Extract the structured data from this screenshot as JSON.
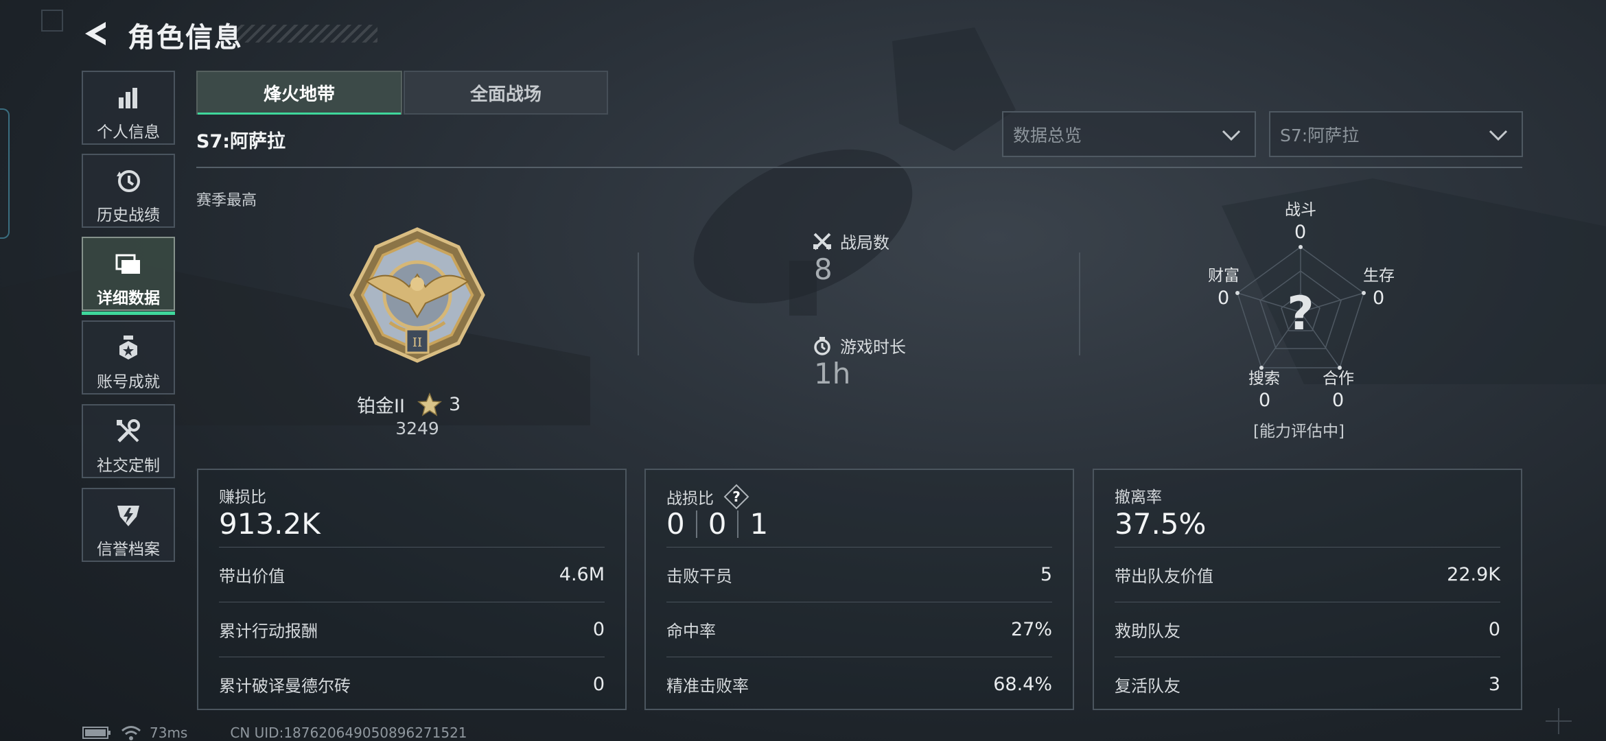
{
  "header": {
    "title": "角色信息"
  },
  "sidebar": {
    "items": [
      {
        "label": "个人信息",
        "icon": "bar-chart-icon"
      },
      {
        "label": "历史战绩",
        "icon": "history-clock-icon"
      },
      {
        "label": "详细数据",
        "icon": "folders-icon",
        "active": true
      },
      {
        "label": "账号成就",
        "icon": "medal-icon"
      },
      {
        "label": "社交定制",
        "icon": "tools-icon"
      },
      {
        "label": "信誉档案",
        "icon": "shield-bolt-icon"
      }
    ]
  },
  "tabs": [
    {
      "label": "烽火地带",
      "active": true
    },
    {
      "label": "全面战场",
      "active": false
    }
  ],
  "season": {
    "title": "S7:阿萨拉"
  },
  "filters": {
    "data_type": "数据总览",
    "season": "S7:阿萨拉"
  },
  "rank": {
    "section_label": "赛季最高",
    "name": "铂金II",
    "stars": "3",
    "score": "3249",
    "badge_numeral": "II"
  },
  "stats": {
    "matches_label": "战局数",
    "matches_value": "8",
    "playtime_label": "游戏时长",
    "playtime_value": "1h"
  },
  "radar": {
    "center_symbol": "?",
    "axes": [
      {
        "label": "战斗",
        "value": "0"
      },
      {
        "label": "生存",
        "value": "0"
      },
      {
        "label": "合作",
        "value": "0"
      },
      {
        "label": "搜索",
        "value": "0"
      },
      {
        "label": "财富",
        "value": "0"
      }
    ],
    "note": "[能力评估中]"
  },
  "panels": {
    "profit": {
      "title": "赚损比",
      "value": "913.2K",
      "rows": [
        {
          "label": "带出价值",
          "value": "4.6M"
        },
        {
          "label": "累计行动报酬",
          "value": "0"
        },
        {
          "label": "累计破译曼德尔砖",
          "value": "0"
        }
      ]
    },
    "combat": {
      "title": "战损比",
      "help": "?",
      "kd": [
        "0",
        "0",
        "1"
      ],
      "rows": [
        {
          "label": "击败干员",
          "value": "5"
        },
        {
          "label": "命中率",
          "value": "27%"
        },
        {
          "label": "精准击败率",
          "value": "68.4%"
        }
      ]
    },
    "extract": {
      "title": "撤离率",
      "value": "37.5%",
      "rows": [
        {
          "label": "带出队友价值",
          "value": "22.9K"
        },
        {
          "label": "救助队友",
          "value": "0"
        },
        {
          "label": "复活队友",
          "value": "3"
        }
      ]
    }
  },
  "status": {
    "ping": "73ms",
    "uid": "CN UID:187620649050896271521"
  },
  "colors": {
    "accent": "#3fd79b",
    "gold": "#c9a45c",
    "background": "#242a31"
  }
}
